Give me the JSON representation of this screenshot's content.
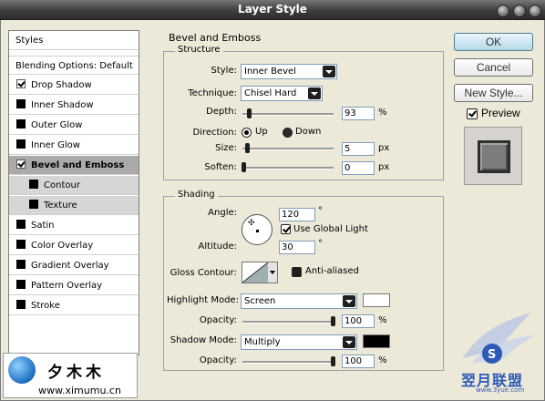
{
  "window": {
    "title": "Layer Style"
  },
  "sidebar": {
    "header": "Styles",
    "blending": "Blending Options: Default",
    "items": [
      {
        "label": "Drop Shadow",
        "checked": true
      },
      {
        "label": "Inner Shadow",
        "checked": false
      },
      {
        "label": "Outer Glow",
        "checked": false
      },
      {
        "label": "Inner Glow",
        "checked": false
      },
      {
        "label": "Bevel and Emboss",
        "checked": true,
        "selected": true
      },
      {
        "label": "Contour",
        "checked": false,
        "sub": true
      },
      {
        "label": "Texture",
        "checked": false,
        "sub": true
      },
      {
        "label": "Satin",
        "checked": false
      },
      {
        "label": "Color Overlay",
        "checked": false
      },
      {
        "label": "Gradient Overlay",
        "checked": false
      },
      {
        "label": "Pattern Overlay",
        "checked": false
      },
      {
        "label": "Stroke",
        "checked": false
      }
    ]
  },
  "bevel": {
    "section_title": "Bevel and Emboss",
    "structure": {
      "title": "Structure",
      "style_label": "Style:",
      "style_value": "Inner Bevel",
      "technique_label": "Technique:",
      "technique_value": "Chisel Hard",
      "depth_label": "Depth:",
      "depth_value": "93",
      "depth_unit": "%",
      "depth_level": 0.05,
      "direction_label": "Direction:",
      "direction_up": "Up",
      "direction_down": "Down",
      "size_label": "Size:",
      "size_value": "5",
      "size_unit": "px",
      "soften_label": "Soften:",
      "soften_value": "0",
      "soften_unit": "px"
    },
    "shading": {
      "title": "Shading",
      "angle_label": "Angle:",
      "angle_value": "120",
      "angle_unit": "°",
      "global_light_label": "Use Global Light",
      "altitude_label": "Altitude:",
      "altitude_value": "30",
      "altitude_unit": "°",
      "gloss_label": "Gloss Contour:",
      "antialiased_label": "Anti-aliased",
      "highlight_label": "Highlight Mode:",
      "highlight_value": "Screen",
      "highlight_color": "#ffffff",
      "opacity_label": "Opacity:",
      "highlight_opacity": "100",
      "opacity_unit": "%",
      "shadow_label": "Shadow Mode:",
      "shadow_value": "Multiply",
      "shadow_color": "#000000",
      "shadow_opacity": "100"
    }
  },
  "buttons": {
    "ok": "OK",
    "cancel": "Cancel",
    "new_style": "New Style...",
    "preview_label": "Preview"
  },
  "watermark": {
    "left_text": "夕木木",
    "left_url": "www.ximumu.cn",
    "right_text": "翌月联盟",
    "right_url": "www.3yue.com"
  }
}
